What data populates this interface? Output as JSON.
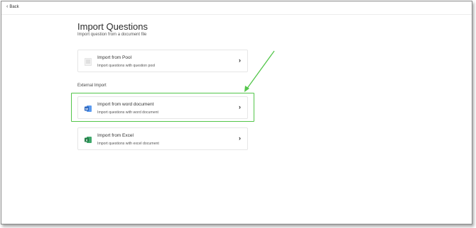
{
  "nav": {
    "back_label": "Back"
  },
  "page": {
    "title": "Import Questions",
    "subtitle": "Import question from a document file"
  },
  "cards": [
    {
      "title": "Import from Pool",
      "subtitle": "Import questions with question pool",
      "icon": "list-icon"
    }
  ],
  "external": {
    "section_label": "External Import",
    "items": [
      {
        "title": "Import from word document",
        "subtitle": "Import questions with word document",
        "icon": "word-icon"
      },
      {
        "title": "Import from Excel",
        "subtitle": "Import questions with excel document",
        "icon": "excel-icon"
      }
    ]
  },
  "colors": {
    "highlight": "#53c64a",
    "word_blue": "#1f5bb8",
    "excel_green": "#1d7a43"
  }
}
